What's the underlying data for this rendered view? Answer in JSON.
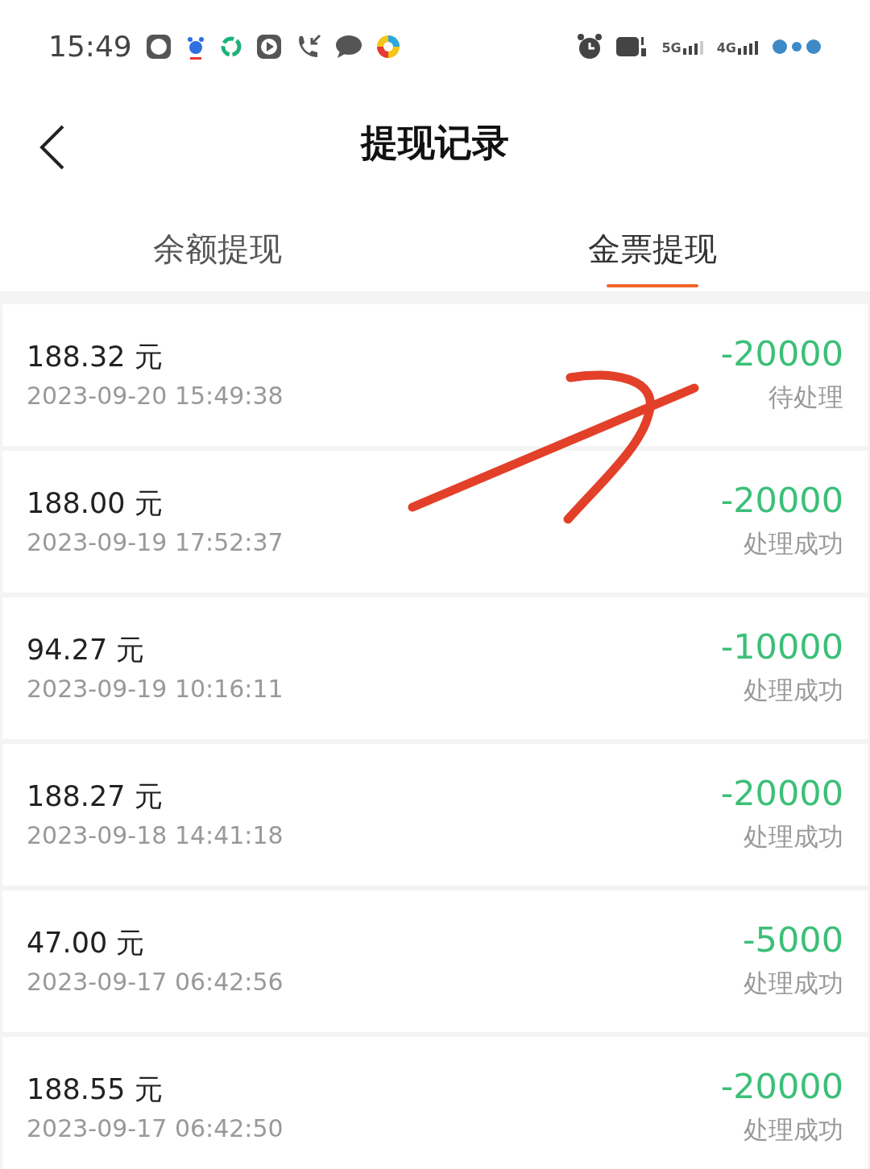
{
  "status_bar": {
    "time": "15:49",
    "network_labels": [
      "5G",
      "4G"
    ]
  },
  "header": {
    "title": "提现记录"
  },
  "tabs": [
    {
      "label": "余额提现",
      "selected": false
    },
    {
      "label": "金票提现",
      "selected": true
    }
  ],
  "records": [
    {
      "amount": "188.32 元",
      "time": "2023-09-20 15:49:38",
      "points": "-20000",
      "status": "待处理"
    },
    {
      "amount": "188.00 元",
      "time": "2023-09-19 17:52:37",
      "points": "-20000",
      "status": "处理成功"
    },
    {
      "amount": "94.27 元",
      "time": "2023-09-19 10:16:11",
      "points": "-10000",
      "status": "处理成功"
    },
    {
      "amount": "188.27 元",
      "time": "2023-09-18 14:41:18",
      "points": "-20000",
      "status": "处理成功"
    },
    {
      "amount": "47.00 元",
      "time": "2023-09-17 06:42:56",
      "points": "-5000",
      "status": "处理成功"
    },
    {
      "amount": "188.55 元",
      "time": "2023-09-17 06:42:50",
      "points": "-20000",
      "status": "处理成功"
    }
  ]
}
